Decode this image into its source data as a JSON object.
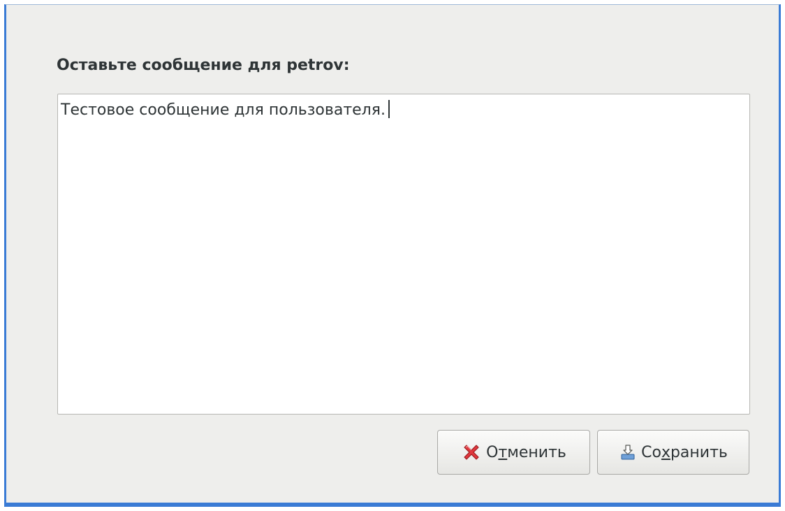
{
  "dialog": {
    "prompt": "Оставьте сообщение для petrov:",
    "message": "Тестовое сообщение для пользователя."
  },
  "buttons": {
    "cancel": {
      "label_pre": "О",
      "label_mnemonic": "т",
      "label_post": "менить",
      "icon": "cancel-red-x-icon"
    },
    "save": {
      "label_pre": "Со",
      "label_mnemonic": "х",
      "label_post": "ранить",
      "icon": "save-download-icon"
    }
  },
  "colors": {
    "window_border": "#3a7bd5",
    "dialog_background": "#eeeeec",
    "cancel_icon": "#e0383e"
  }
}
